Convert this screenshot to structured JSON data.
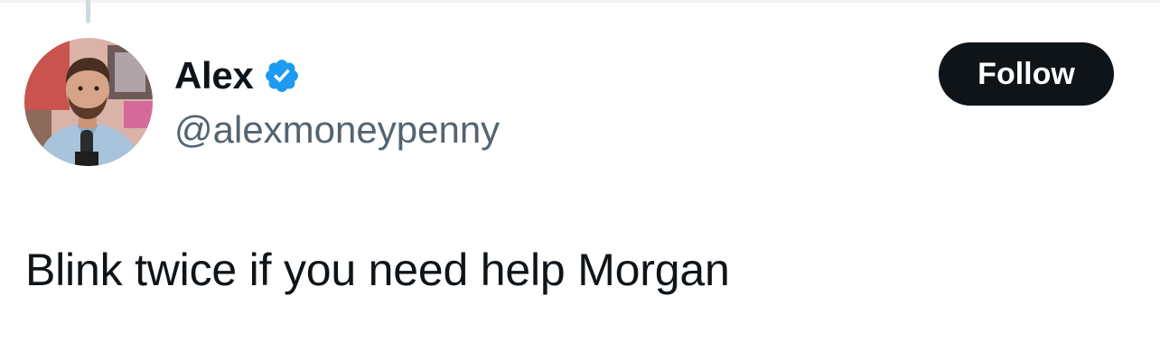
{
  "author": {
    "display_name": "Alex",
    "handle": "@alexmoneypenny",
    "verified": true,
    "verified_icon": "verified-badge-icon",
    "avatar": "profile-photo"
  },
  "follow_button": {
    "label": "Follow"
  },
  "tweet": {
    "text": "Blink twice if you need help Morgan"
  },
  "colors": {
    "text_primary": "#0f1419",
    "text_secondary": "#536471",
    "verified_blue": "#1d9bf0",
    "button_bg": "#0f1419",
    "thread_line": "#cfd9de"
  }
}
